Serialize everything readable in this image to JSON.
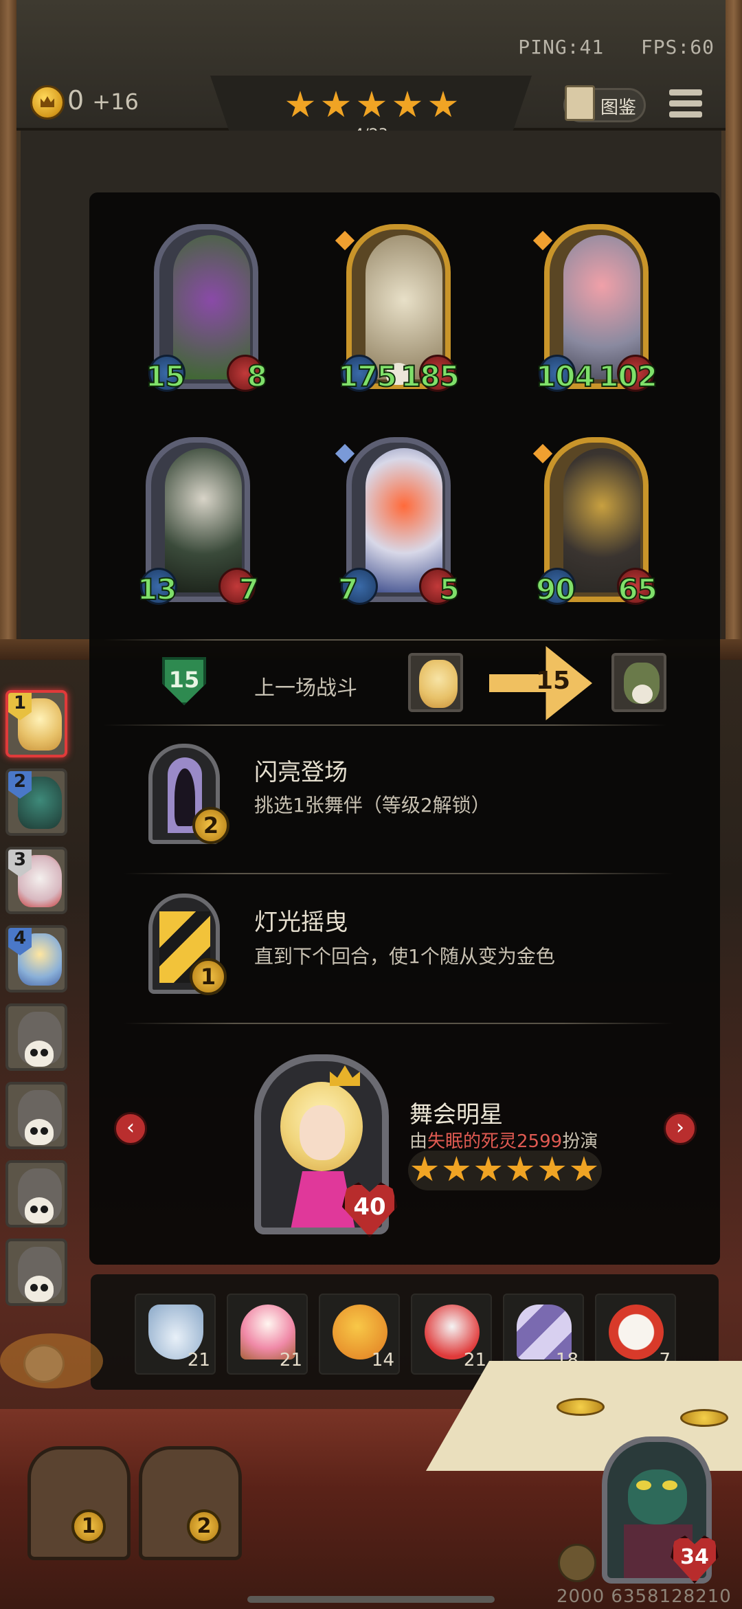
{
  "status": {
    "ping": "PING:41",
    "fps": "FPS:60"
  },
  "gold": {
    "amount": "0",
    "income": "+16"
  },
  "tier": {
    "stars": 5,
    "progress_text": "4/23",
    "progress_fraction": 0.174
  },
  "encyclopedia_label": "图鉴",
  "minions": [
    {
      "name": "purple-dragon",
      "attack": "15",
      "health": "8",
      "golden": false,
      "skull": false
    },
    {
      "name": "bone-dragon",
      "attack": "175",
      "health": "185",
      "golden": true,
      "skull": true
    },
    {
      "name": "armored-heroine",
      "attack": "104",
      "health": "102",
      "golden": true,
      "skull": false
    },
    {
      "name": "hooded-reaper",
      "attack": "13",
      "health": "7",
      "golden": false,
      "skull": false
    },
    {
      "name": "evil-clown",
      "attack": "7",
      "health": "5",
      "golden": false,
      "skull": false
    },
    {
      "name": "treasure-golem",
      "attack": "90",
      "health": "65",
      "golden": true,
      "skull": false
    }
  ],
  "last_battle": {
    "rank": "15",
    "label": "上一场战斗",
    "damage": "15"
  },
  "abilities": [
    {
      "title": "闪亮登场",
      "desc": "挑选1张舞伴（等级2解锁）",
      "cost": "2"
    },
    {
      "title": "灯光摇曳",
      "desc": "直到下个回合，使1个随从变为金色",
      "cost": "1"
    }
  ],
  "hero": {
    "name": "舞会明星",
    "credit_prefix": "由",
    "credit_player": "失眠的死灵2599",
    "credit_suffix": "扮演",
    "health": "40",
    "stars": 6
  },
  "items": [
    {
      "icon": "teacup-icon",
      "count": "21"
    },
    {
      "icon": "cupcake-icon",
      "count": "21"
    },
    {
      "icon": "rubber-chicken-icon",
      "count": "14"
    },
    {
      "icon": "clown-head-icon",
      "count": "21"
    },
    {
      "icon": "striped-shield-icon",
      "count": "18"
    },
    {
      "icon": "alarm-clock-icon",
      "count": "7"
    }
  ],
  "hand": [
    {
      "num": "1",
      "color": "#e8c040",
      "active": true
    },
    {
      "num": "2",
      "color": "#4a78c8",
      "active": false
    },
    {
      "num": "3",
      "color": "#c8c8c8",
      "active": false
    },
    {
      "num": "4",
      "color": "#4a78c8",
      "active": false
    },
    {
      "num": "",
      "color": "",
      "active": false
    },
    {
      "num": "",
      "color": "",
      "active": false
    },
    {
      "num": "",
      "color": "",
      "active": false
    },
    {
      "num": "",
      "color": "",
      "active": false
    }
  ],
  "chests": [
    "1",
    "2"
  ],
  "player": {
    "health": "34",
    "id": "2000 6358128210"
  },
  "colors": {
    "accent_gold": "#f0a424",
    "stat_green": "#7fe06a",
    "hp_red": "#b82c2c"
  }
}
